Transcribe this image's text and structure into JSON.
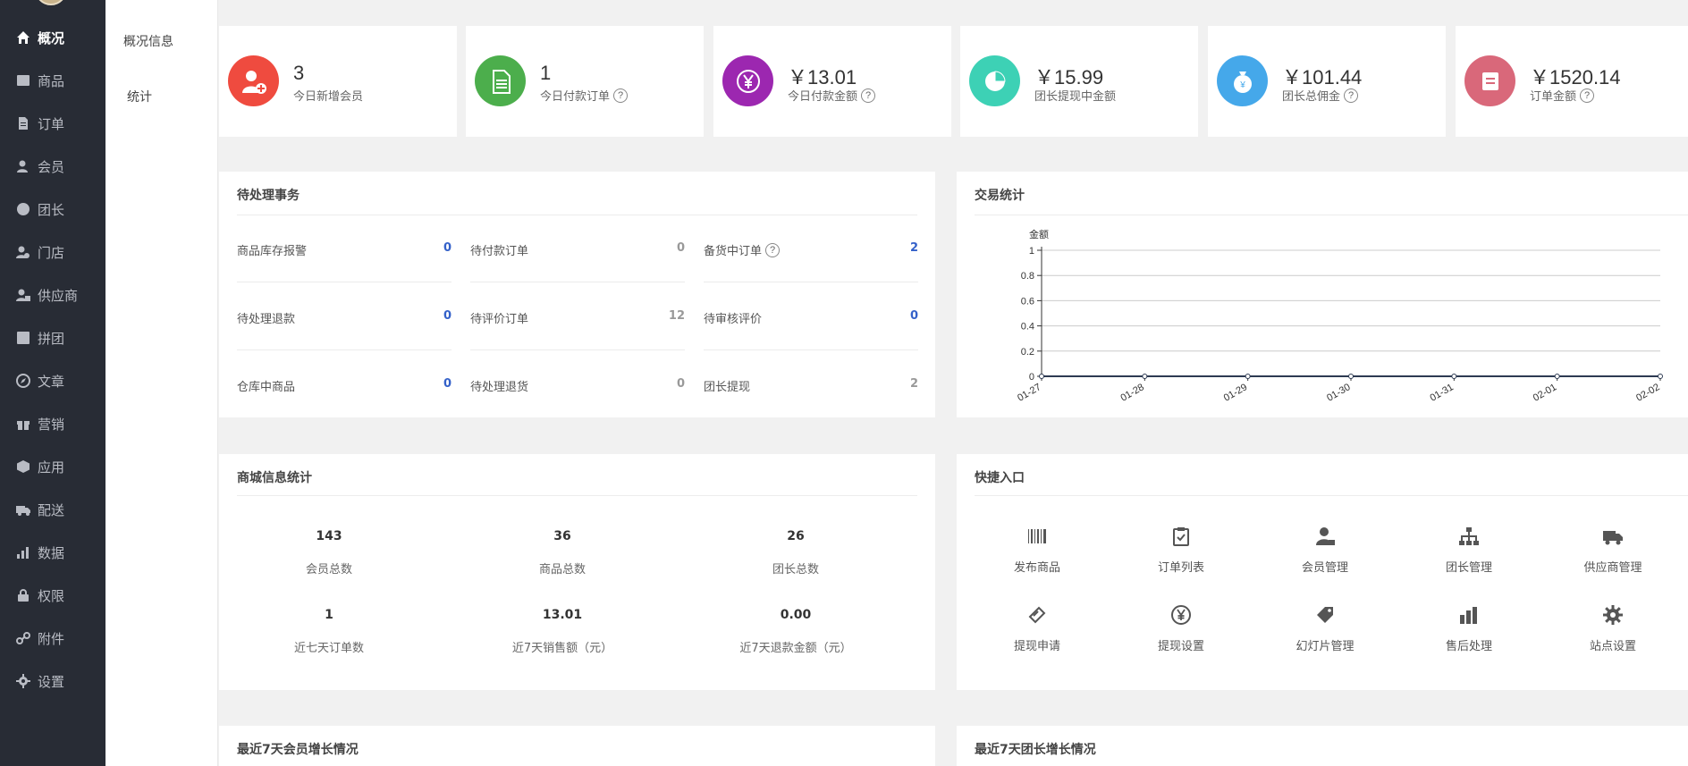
{
  "nav": {
    "items": [
      {
        "label": "概况",
        "icon": "home-icon",
        "active": true
      },
      {
        "label": "商品",
        "icon": "goods-icon"
      },
      {
        "label": "订单",
        "icon": "order-icon"
      },
      {
        "label": "会员",
        "icon": "member-icon"
      },
      {
        "label": "团长",
        "icon": "leader-icon"
      },
      {
        "label": "门店",
        "icon": "store-icon"
      },
      {
        "label": "供应商",
        "icon": "supplier-icon"
      },
      {
        "label": "拼团",
        "icon": "group-buy-icon"
      },
      {
        "label": "文章",
        "icon": "article-icon"
      },
      {
        "label": "营销",
        "icon": "gift-icon"
      },
      {
        "label": "应用",
        "icon": "app-icon"
      },
      {
        "label": "配送",
        "icon": "truck-icon"
      },
      {
        "label": "数据",
        "icon": "data-icon"
      },
      {
        "label": "权限",
        "icon": "lock-icon"
      },
      {
        "label": "附件",
        "icon": "link-icon"
      },
      {
        "label": "设置",
        "icon": "gear-icon"
      }
    ]
  },
  "subnav": {
    "items": [
      {
        "label": "概况信息"
      },
      {
        "label": "统计"
      }
    ]
  },
  "stats": [
    {
      "value": "3",
      "label": "今日新增会员",
      "help": false,
      "color": "#ef4b3f",
      "icon": "user-add-icon"
    },
    {
      "value": "1",
      "label": "今日付款订单",
      "help": true,
      "color": "#4cae4c",
      "icon": "document-icon"
    },
    {
      "value": "￥13.01",
      "label": "今日付款金额",
      "help": true,
      "color": "#9c27b0",
      "icon": "yen-icon"
    },
    {
      "value": "￥15.99",
      "label": "团长提现中金额",
      "help": false,
      "color": "#3dd1b5",
      "icon": "pie-icon"
    },
    {
      "value": "￥101.44",
      "label": "团长总佣金",
      "help": true,
      "color": "#45a8ea",
      "icon": "money-bag-icon"
    },
    {
      "value": "￥1520.14",
      "label": "订单金额",
      "help": true,
      "color": "#d9687a",
      "icon": "list-box-icon"
    }
  ],
  "help_mark": "?",
  "todo": {
    "title": "待处理事务",
    "items": [
      {
        "label": "商品库存报警",
        "count": "0",
        "help": false,
        "accent": true
      },
      {
        "label": "待处理退款",
        "count": "0",
        "help": false,
        "accent": true
      },
      {
        "label": "仓库中商品",
        "count": "0",
        "help": false,
        "accent": true
      },
      {
        "label": "待付款订单",
        "count": "0",
        "help": false,
        "accent": false
      },
      {
        "label": "待评价订单",
        "count": "12",
        "help": false,
        "accent": false
      },
      {
        "label": "待处理退货",
        "count": "0",
        "help": false,
        "accent": false
      },
      {
        "label": "备货中订单",
        "count": "2",
        "help": true,
        "accent": true
      },
      {
        "label": "待审核评价",
        "count": "0",
        "help": false,
        "accent": true
      },
      {
        "label": "团长提现",
        "count": "2",
        "help": false,
        "accent": false
      }
    ],
    "colors": {
      "accent": "#3461c9",
      "muted": "#999999"
    }
  },
  "trade": {
    "title": "交易统计"
  },
  "chart_data": {
    "type": "line",
    "ylabel": "金额",
    "xlabel": "",
    "categories": [
      "01-27",
      "01-28",
      "01-29",
      "01-30",
      "01-31",
      "02-01",
      "02-02"
    ],
    "series": [
      {
        "values": [
          0,
          0,
          0,
          0,
          0,
          0,
          0
        ]
      }
    ],
    "ylim": [
      0,
      1
    ],
    "yticks": [
      "0",
      "0.2",
      "0.4",
      "0.6",
      "0.8",
      "1"
    ],
    "grid": true
  },
  "shop_info": {
    "title": "商城信息统计",
    "cells": [
      {
        "value": "143",
        "label": "会员总数"
      },
      {
        "value": "36",
        "label": "商品总数"
      },
      {
        "value": "26",
        "label": "团长总数"
      },
      {
        "value": "1",
        "label": "近七天订单数"
      },
      {
        "value": "13.01",
        "label": "近7天销售额（元）"
      },
      {
        "value": "0.00",
        "label": "近7天退款金额（元）"
      }
    ]
  },
  "quick": {
    "title": "快捷入口",
    "items": [
      {
        "label": "发布商品",
        "icon": "barcode-icon"
      },
      {
        "label": "订单列表",
        "icon": "clipboard-check-icon"
      },
      {
        "label": "会员管理",
        "icon": "member-manage-icon"
      },
      {
        "label": "团长管理",
        "icon": "org-chart-icon"
      },
      {
        "label": "供应商管理",
        "icon": "truck-icon"
      },
      {
        "label": "提现申请",
        "icon": "ticket-icon"
      },
      {
        "label": "提现设置",
        "icon": "yen-circle-icon"
      },
      {
        "label": "幻灯片管理",
        "icon": "tag-icon"
      },
      {
        "label": "售后处理",
        "icon": "bar-chart-icon"
      },
      {
        "label": "站点设置",
        "icon": "gear-icon"
      }
    ]
  },
  "bottom": {
    "member_growth_title": "最近7天会员增长情况",
    "leader_growth_title": "最近7天团长增长情况"
  }
}
